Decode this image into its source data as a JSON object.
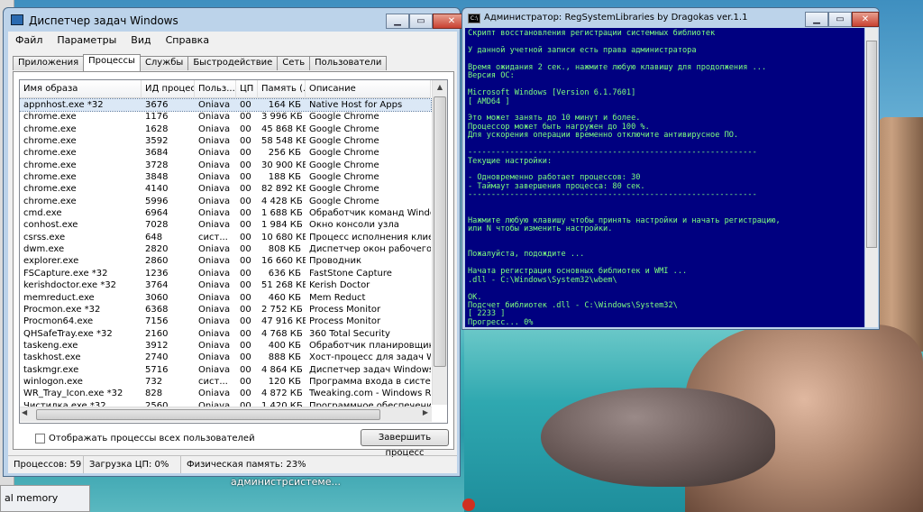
{
  "task_manager": {
    "title": "Диспетчер задач Windows",
    "menu": [
      "Файл",
      "Параметры",
      "Вид",
      "Справка"
    ],
    "tabs": [
      "Приложения",
      "Процессы",
      "Службы",
      "Быстродействие",
      "Сеть",
      "Пользователи"
    ],
    "active_tab": "Процессы",
    "columns": [
      "Имя образа",
      "ИД процесса",
      "Польз...",
      "ЦП",
      "Память (...",
      "Описание"
    ],
    "rows": [
      [
        "appnhost.exe *32",
        "3676",
        "Oniava",
        "00",
        "164 КБ",
        "Native Host for Apps"
      ],
      [
        "chrome.exe",
        "1176",
        "Oniava",
        "00",
        "3 996 КБ",
        "Google Chrome"
      ],
      [
        "chrome.exe",
        "1628",
        "Oniava",
        "00",
        "45 868 КБ",
        "Google Chrome"
      ],
      [
        "chrome.exe",
        "3592",
        "Oniava",
        "00",
        "58 548 КБ",
        "Google Chrome"
      ],
      [
        "chrome.exe",
        "3684",
        "Oniava",
        "00",
        "256 КБ",
        "Google Chrome"
      ],
      [
        "chrome.exe",
        "3728",
        "Oniava",
        "00",
        "30 900 КБ",
        "Google Chrome"
      ],
      [
        "chrome.exe",
        "3848",
        "Oniava",
        "00",
        "188 КБ",
        "Google Chrome"
      ],
      [
        "chrome.exe",
        "4140",
        "Oniava",
        "00",
        "82 892 КБ",
        "Google Chrome"
      ],
      [
        "chrome.exe",
        "5996",
        "Oniava",
        "00",
        "4 428 КБ",
        "Google Chrome"
      ],
      [
        "cmd.exe",
        "6964",
        "Oniava",
        "00",
        "1 688 КБ",
        "Обработчик команд Windows"
      ],
      [
        "conhost.exe",
        "7028",
        "Oniava",
        "00",
        "1 984 КБ",
        "Окно консоли узла"
      ],
      [
        "csrss.exe",
        "648",
        "сист...",
        "00",
        "10 680 КБ",
        "Процесс исполнения клиент-серве"
      ],
      [
        "dwm.exe",
        "2820",
        "Oniava",
        "00",
        "808 КБ",
        "Диспетчер окон рабочего стола"
      ],
      [
        "explorer.exe",
        "2860",
        "Oniava",
        "00",
        "16 660 КБ",
        "Проводник"
      ],
      [
        "FSCapture.exe *32",
        "1236",
        "Oniava",
        "00",
        "636 КБ",
        "FastStone Capture"
      ],
      [
        "kerishdoctor.exe *32",
        "3764",
        "Oniava",
        "00",
        "51 268 КБ",
        "Kerish Doctor"
      ],
      [
        "memreduct.exe",
        "3060",
        "Oniava",
        "00",
        "460 КБ",
        "Mem Reduct"
      ],
      [
        "Procmon.exe *32",
        "6368",
        "Oniava",
        "00",
        "2 752 КБ",
        "Process Monitor"
      ],
      [
        "Procmon64.exe",
        "7156",
        "Oniava",
        "00",
        "47 916 КБ",
        "Process Monitor"
      ],
      [
        "QHSafeTray.exe *32",
        "2160",
        "Oniava",
        "00",
        "4 768 КБ",
        "360 Total Security"
      ],
      [
        "taskeng.exe",
        "3912",
        "Oniava",
        "00",
        "400 КБ",
        "Обработчик планировщика задан"
      ],
      [
        "taskhost.exe",
        "2740",
        "Oniava",
        "00",
        "888 КБ",
        "Хост-процесс для задач Windows"
      ],
      [
        "taskmgr.exe",
        "5716",
        "Oniava",
        "00",
        "4 864 КБ",
        "Диспетчер задач Windows"
      ],
      [
        "winlogon.exe",
        "732",
        "сист...",
        "00",
        "120 КБ",
        "Программа входа в систему Windo"
      ],
      [
        "WR_Tray_Icon.exe *32",
        "828",
        "Oniava",
        "00",
        "4 872 КБ",
        "Tweaking.com - Windows Repair Tra"
      ],
      [
        "Чистилка.exe *32",
        "2560",
        "Oniava",
        "00",
        "1 420 КБ",
        "Программное обеспечение для уд"
      ]
    ],
    "show_all_label": "Отображать процессы всех пользователей",
    "end_process_label": "Завершить процесс",
    "status": {
      "processes": "Процессов: 59",
      "cpu": "Загрузка ЦП: 0%",
      "memory": "Физическая память: 23%"
    }
  },
  "console": {
    "title": "Администратор:  RegSystemLibraries by Dragokas ver.1.1",
    "lines": [
      "Скрипт восстановления регистрации системных библиотек",
      "",
      "У данной учетной записи есть права администратора",
      "",
      "Время ожидания 2 сек., нажмите любую клавишу для продолжения ...",
      "Версия ОС:",
      "",
      "Microsoft Windows [Version 6.1.7601]",
      "[ AMD64 ]",
      "",
      "Это может занять до 10 минут и более.",
      "Процессор может быть нагружен до 100 %.",
      "Для ускорения операции временно отключите антивирусное ПО.",
      "",
      "--------------------------------------------------------------",
      "Текущие настройки:",
      "",
      "- Одновременно работает процессов: 30",
      "- Таймаут завершения процесса: 80 сек.",
      "--------------------------------------------------------------",
      "",
      "",
      "Нажмите любую клавишу чтобы принять настройки и начать регистрацию,",
      "или N чтобы изменить настройки.",
      "",
      "",
      "Пожалуйста, подождите ...",
      "",
      "Начата регистрация основных библиотек и WMI ...",
      ".dll - C:\\Windows\\System32\\wbem\\",
      "",
      "OK.",
      "Подсчет библиотек .dll - C:\\Windows\\System32\\",
      "[ 2233 ]",
      "Прогресс... 0%"
    ]
  },
  "desktop": {
    "taskbar_item": "al memory",
    "icon_labels": [
      "администр...",
      "систeме..."
    ]
  }
}
